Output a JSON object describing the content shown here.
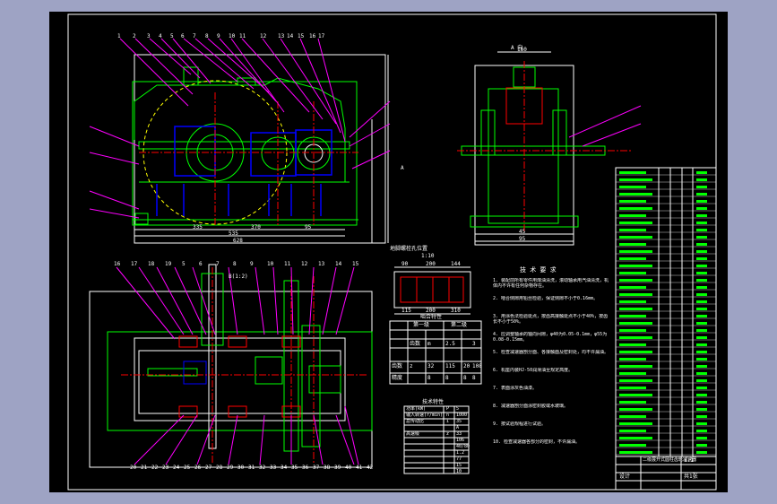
{
  "drawing": {
    "view_arrow_label": "A 向",
    "section_arrow_label": "A",
    "top_part_numbers": [
      "1",
      "2",
      "3",
      "4",
      "5",
      "6",
      "7",
      "8",
      "9",
      "10",
      "11",
      "12",
      "13",
      "14",
      "15",
      "16",
      "17"
    ],
    "front_dims": [
      "335",
      "370",
      "95",
      "535",
      "628"
    ],
    "side_dims": [
      "45",
      "95",
      "160"
    ],
    "plan_top_numbers": [
      "16",
      "17",
      "18",
      "19",
      "5",
      "6",
      "7",
      "8",
      "9",
      "10",
      "11",
      "12",
      "13",
      "14",
      "15"
    ],
    "plan_bottom_numbers": [
      "20",
      "21",
      "22",
      "23",
      "24",
      "25",
      "26",
      "27",
      "28",
      "29",
      "30",
      "31",
      "32",
      "33",
      "34",
      "35",
      "36",
      "37",
      "38",
      "39",
      "40",
      "41",
      "42"
    ],
    "plan_title_left": "B(1:2)",
    "detail_title": "地脚螺栓孔位置",
    "detail_scale": "1:10",
    "detail_dims": [
      "90",
      "200",
      "144"
    ],
    "detail_bottom_dims": [
      "115",
      "200",
      "310"
    ]
  },
  "mesh_table": {
    "title": "啮合特性",
    "col_groups": [
      "第一级",
      "第二级"
    ],
    "rows": [
      [
        "",
        "齿数",
        "m",
        "2.5",
        "",
        "3"
      ],
      [
        "齿数",
        "z",
        "32",
        "115",
        "20",
        "108"
      ],
      [
        "精度",
        "",
        "8",
        "8",
        "8",
        "8"
      ]
    ]
  },
  "spec_table": {
    "title": "技术特性",
    "rows": [
      [
        "功率(kW)",
        "P",
        "5"
      ],
      [
        "输入转速(r/min)",
        "n",
        "1000"
      ],
      [
        "总传动比",
        "i",
        "35"
      ],
      [
        "",
        "",
        "A"
      ],
      [
        "高速级",
        "z",
        "33"
      ],
      [
        "",
        "",
        "106"
      ],
      [
        "",
        "",
        "40/80"
      ],
      [
        "",
        "",
        "1.2"
      ],
      [
        "",
        "",
        "77"
      ],
      [
        "",
        "",
        "15"
      ],
      [
        "",
        "",
        "10"
      ]
    ]
  },
  "tech_req": {
    "title": "技 术 要 求",
    "items": [
      "1. 装配前所有零件用煤油清洗，滚动轴承用汽油清洗，机体内不许有任何杂物存在。",
      "2. 啮合侧隙用铅丝检验，保证侧隙不小于0.16mm。",
      "3. 用涂色法检验斑点，按齿高接触斑点不小于40%，按齿长不小于50%。",
      "4. 应调整轴承的轴向间隙，φ40为0.05-0.1mm，φ55为0.08-0.15mm。",
      "5. 检查减速器剖分面、各接触面及密封处，均不许漏油。",
      "6. 机座内装HJ-50润滑油至规定高度。",
      "7. 表面涂灰色油漆。",
      "8. 减速器剖分面涂密封胶或水玻璃。",
      "9. 按试验规程进行试验。",
      "10. 检查减速器各部分的密封，不许漏油。"
    ]
  },
  "title_block": {
    "drawing_name": "二级展开式圆柱齿轮减速器",
    "scale": "1:1",
    "designer": "设计",
    "sheet": "共1张"
  }
}
